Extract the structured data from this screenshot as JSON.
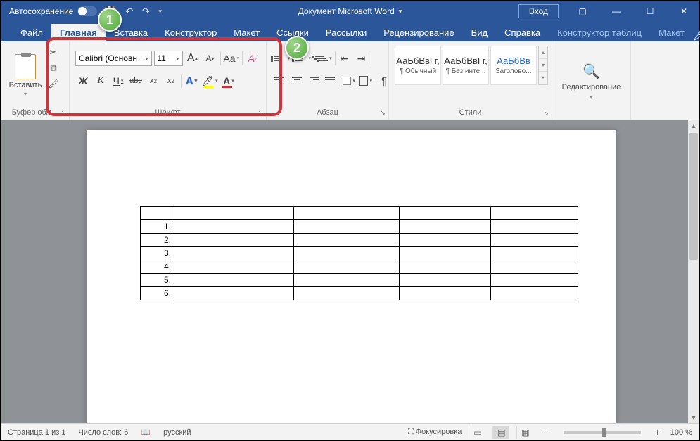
{
  "titlebar": {
    "autosave": "Автосохранение",
    "document": "Документ Microsoft Word",
    "login": "Вход"
  },
  "tabs": {
    "file": "Файл",
    "home": "Главная",
    "insert": "Вставка",
    "design": "Конструктор",
    "layout": "Макет",
    "references": "Ссылки",
    "mailings": "Рассылки",
    "review": "Рецензирование",
    "view": "Вид",
    "help": "Справка",
    "table_design": "Конструктор таблиц",
    "table_layout": "Макет"
  },
  "ribbon": {
    "clipboard": {
      "paste": "Вставить",
      "label": "Буфер обм..."
    },
    "font": {
      "name": "Calibri (Основн",
      "size": "11",
      "label": "Шрифт",
      "grow": "A",
      "shrink": "A",
      "case": "Aa",
      "clear": "A",
      "bold": "Ж",
      "italic": "К",
      "underline": "Ч",
      "strike": "abc",
      "sub": "x",
      "sup": "x",
      "effects": "A",
      "highlight": "",
      "color": "A"
    },
    "paragraph": {
      "label": "Абзац",
      "pilcrow": "¶"
    },
    "styles": {
      "label": "Стили",
      "items": [
        {
          "preview": "АаБбВвГг,",
          "name": "¶ Обычный"
        },
        {
          "preview": "АаБбВвГг,",
          "name": "¶ Без инте..."
        },
        {
          "preview": "АаБбВв",
          "name": "Заголово..."
        }
      ]
    },
    "editing": {
      "label": "Редактирование"
    }
  },
  "table_rows": [
    "1.",
    "2.",
    "3.",
    "4.",
    "5.",
    "6."
  ],
  "statusbar": {
    "page": "Страница 1 из 1",
    "words": "Число слов: 6",
    "lang": "русский",
    "focus": "Фокусировка",
    "zoom": "100 %"
  },
  "markers": {
    "m1": "1",
    "m2": "2"
  }
}
